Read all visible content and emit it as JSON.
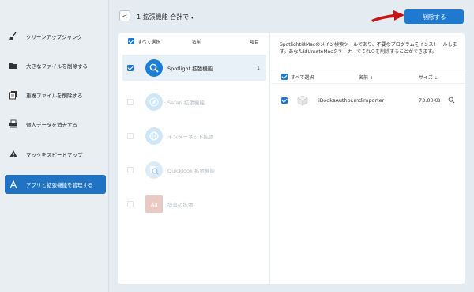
{
  "sidebar": {
    "items": [
      {
        "label": "クリーンアップジャンク",
        "icon": "broom-icon",
        "active": false
      },
      {
        "label": "大きなファイルを削除する",
        "icon": "folder-icon",
        "active": false
      },
      {
        "label": "重複ファイルを削除する",
        "icon": "duplicate-files-icon",
        "active": false
      },
      {
        "label": "個人データを消去する",
        "icon": "shredder-icon",
        "active": false
      },
      {
        "label": "マックをスピードアップ",
        "icon": "warning-speed-icon",
        "active": false
      },
      {
        "label": "アプリと拡張機能を管理する",
        "icon": "apps-tools-icon",
        "active": true
      }
    ]
  },
  "header": {
    "back_label": "<",
    "title": "1 拡張機能 合計で",
    "dropdown_glyph": "▾",
    "delete_label": "削除する"
  },
  "ext_list": {
    "select_all_label": "すべて選択",
    "name_header": "名前",
    "count_header": "項目",
    "items": [
      {
        "name": "Spotlight 拡張機能",
        "count": "1",
        "checked": true,
        "selected": true,
        "enabled": true,
        "icon": "spotlight-search-icon"
      },
      {
        "name": "Safari 拡張機能",
        "count": "",
        "checked": false,
        "selected": false,
        "enabled": false,
        "icon": "safari-compass-icon"
      },
      {
        "name": "インターネット拡張",
        "count": "",
        "checked": false,
        "selected": false,
        "enabled": false,
        "icon": "internet-globe-icon"
      },
      {
        "name": "Quicklook 拡張機能",
        "count": "",
        "checked": false,
        "selected": false,
        "enabled": false,
        "icon": "quicklook-magnifier-icon"
      },
      {
        "name": "辞書の拡張",
        "count": "",
        "checked": false,
        "selected": false,
        "enabled": false,
        "icon": "dictionary-icon"
      }
    ]
  },
  "detail": {
    "description": "SpotlightはMacのメイン検索ツールであり、不要なプログラムをインストールします。あなたはUmateMacクリーナーでそれらを削除することができます。",
    "select_all_label": "すべて選択",
    "name_header": "名前",
    "size_header": "サイズ",
    "files": [
      {
        "name": "iBooksAuthor.mdimporter",
        "size": "73.00KB",
        "checked": true,
        "icon": "package-box-icon"
      }
    ]
  },
  "colors": {
    "accent": "#1f79cf",
    "active_sidebar": "#1f73c2",
    "arrow": "#c81414"
  }
}
